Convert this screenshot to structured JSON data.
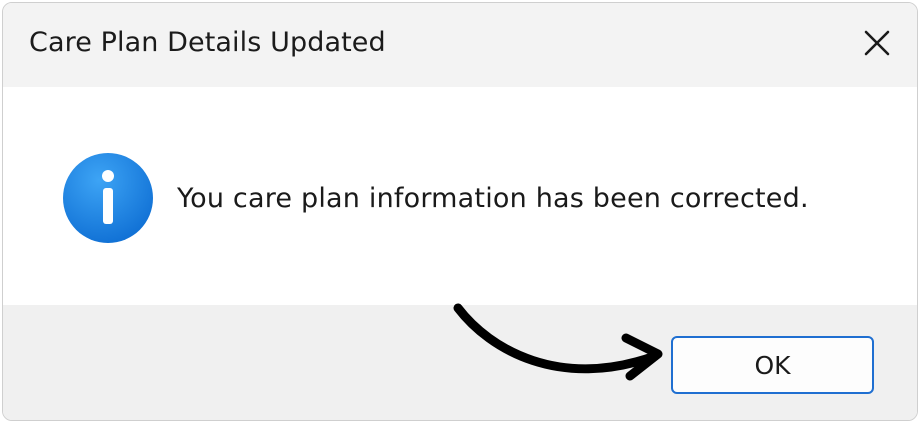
{
  "dialog": {
    "title": "Care Plan Details Updated",
    "message": "You care plan information has been corrected.",
    "ok_label": "OK",
    "icon": "info-icon",
    "close_icon": "close-icon"
  },
  "colors": {
    "accent": "#1f6fd1",
    "info_icon": "#1b7fe0",
    "titlebar": "#f3f3f3",
    "footer": "#f0f0f0"
  }
}
